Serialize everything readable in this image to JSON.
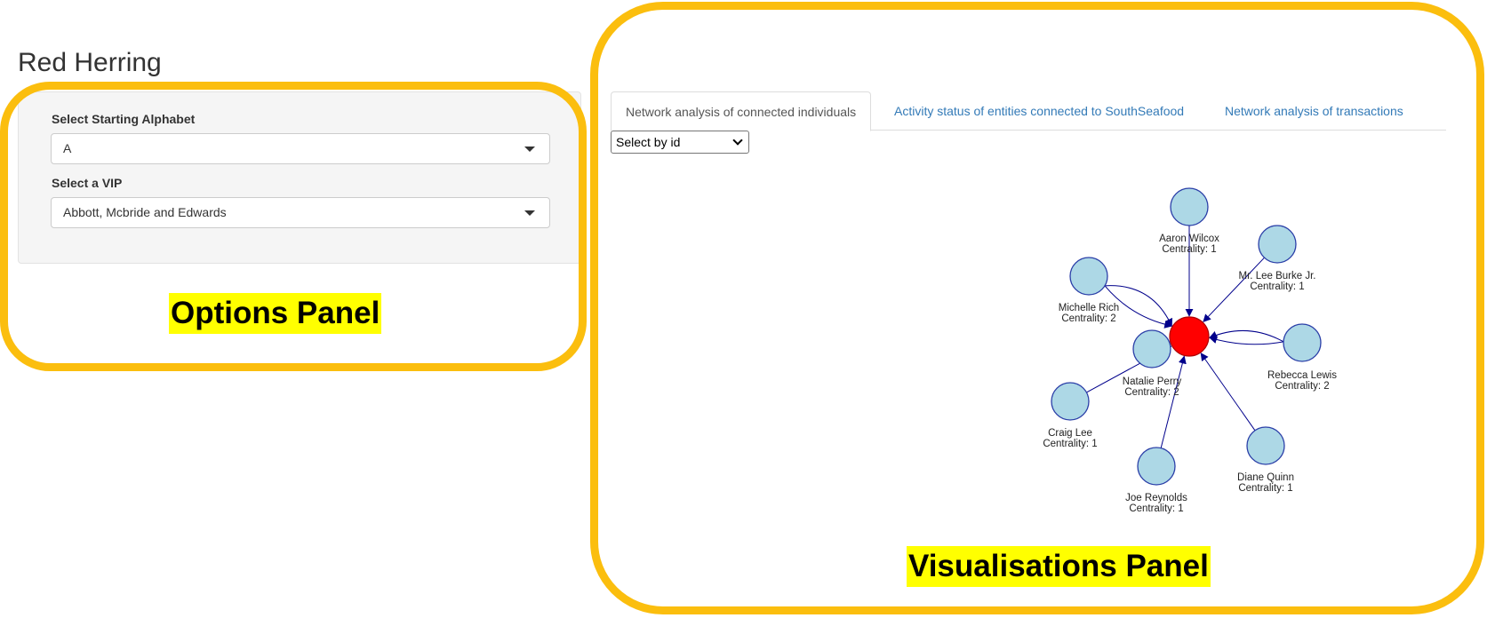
{
  "app": {
    "title": "Red Herring"
  },
  "options_panel": {
    "alphabet_label": "Select Starting Alphabet",
    "alphabet_value": "A",
    "vip_label": "Select a VIP",
    "vip_value": "Abbott, Mcbride and Edwards"
  },
  "annotations": {
    "options_panel": "Options Panel",
    "visualisations_panel": "Visualisations Panel"
  },
  "tabs": [
    {
      "label": "Network analysis of connected individuals",
      "active": true
    },
    {
      "label": "Activity status of entities connected to SouthSeafood",
      "active": false
    },
    {
      "label": "Network analysis of transactions",
      "active": false
    }
  ],
  "network": {
    "select_placeholder": "Select by id",
    "node_color": "#add8e6",
    "center_color": "#ff0000",
    "edge_color": "#00008b",
    "center": {
      "id": "center"
    },
    "nodes": [
      {
        "name": "Aaron Wilcox",
        "centrality": "Centrality: 1"
      },
      {
        "name": "Mr. Lee Burke Jr.",
        "centrality": "Centrality: 1"
      },
      {
        "name": "Michelle Rich",
        "centrality": "Centrality: 2"
      },
      {
        "name": "Rebecca Lewis",
        "centrality": "Centrality: 2"
      },
      {
        "name": "Natalie Perry",
        "centrality": "Centrality: 2"
      },
      {
        "name": "Craig Lee",
        "centrality": "Centrality: 1"
      },
      {
        "name": "Diane Quinn",
        "centrality": "Centrality: 1"
      },
      {
        "name": "Joe Reynolds",
        "centrality": "Centrality: 1"
      }
    ]
  }
}
